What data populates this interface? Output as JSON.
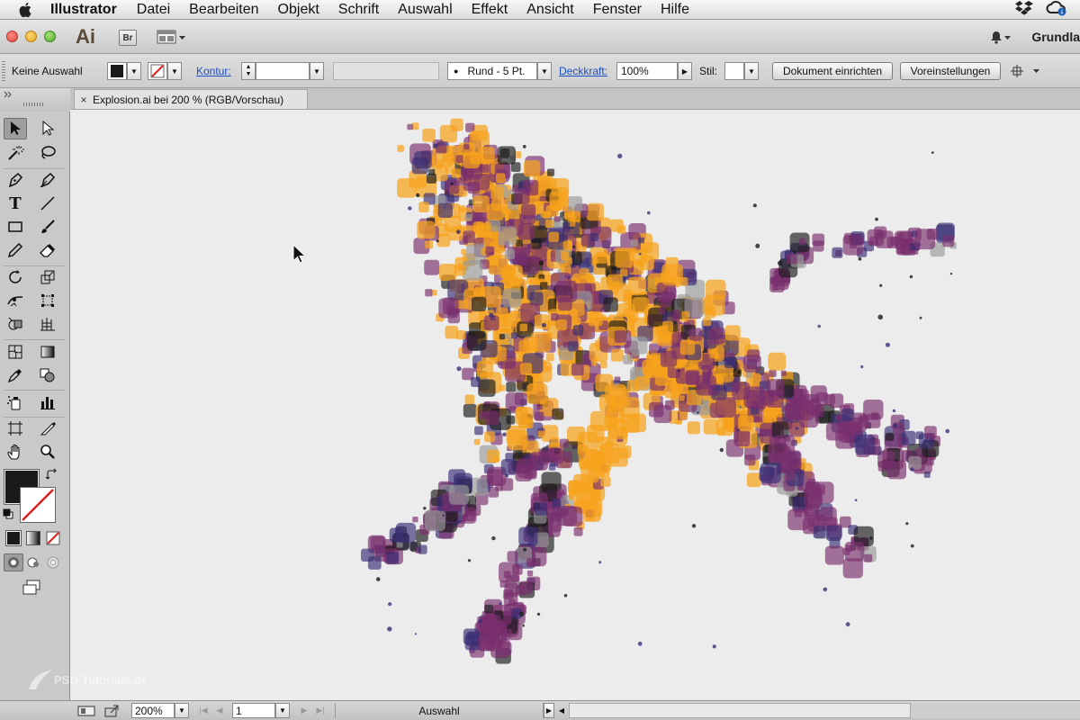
{
  "menubar": {
    "app_name": "Illustrator",
    "items": [
      "Datei",
      "Bearbeiten",
      "Objekt",
      "Schrift",
      "Auswahl",
      "Effekt",
      "Ansicht",
      "Fenster",
      "Hilfe"
    ],
    "status_icons": [
      "dropbox-icon",
      "creative-cloud-icon"
    ]
  },
  "appbar": {
    "app_logo": "Ai",
    "bridge_logo": "Br",
    "workspace": "Grundla"
  },
  "controlbar": {
    "selection_label": "Keine Auswahl",
    "stroke_label": "Kontur:",
    "brush_label": "Rund - 5 Pt.",
    "opacity_label": "Deckkraft:",
    "opacity_value": "100%",
    "style_label": "Stil:",
    "document_setup_button": "Dokument einrichten",
    "preferences_button": "Voreinstellungen"
  },
  "document": {
    "tab_title": "Explosion.ai bei 200 % (RGB/Vorschau)",
    "close_symbol": "×"
  },
  "statusbar": {
    "zoom": "200%",
    "artboard": "1",
    "tool_status": "Auswahl"
  },
  "watermark": "PSD-Tutorials.de",
  "colors": {
    "orange": "#f7a21c",
    "purple": "#7a2f6e",
    "navy": "#3a2f75",
    "black": "#1a1a1a",
    "grey": "#9a9a9a"
  }
}
